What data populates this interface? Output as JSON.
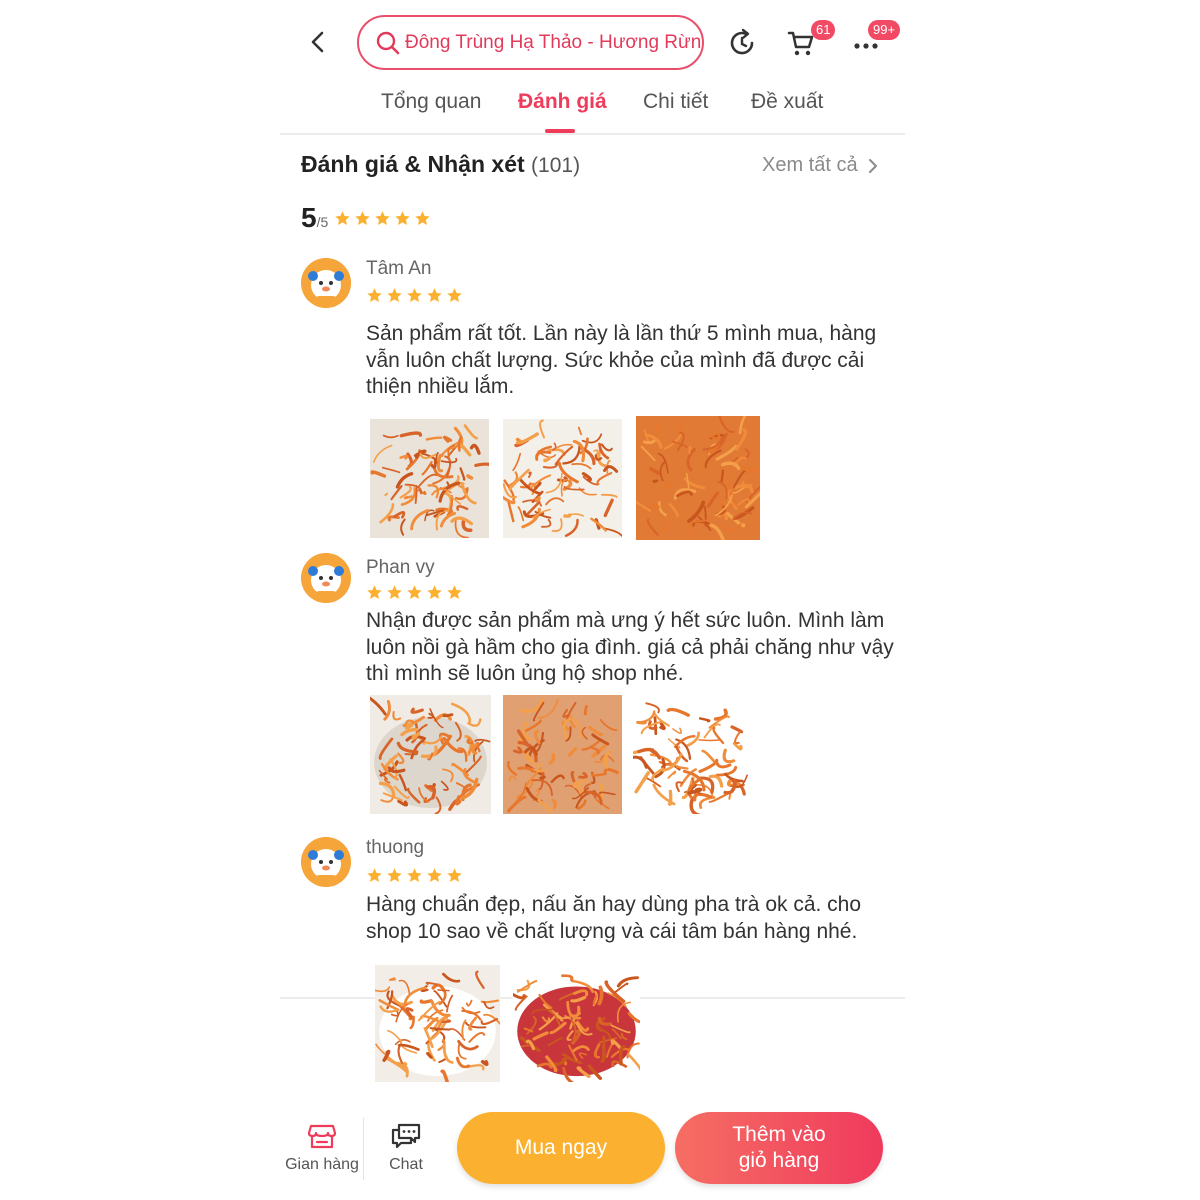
{
  "header": {
    "search_text": "Đông Trùng Hạ Thảo -  Hương Rừng",
    "cart_badge": "61",
    "more_badge": "99+"
  },
  "tabs": [
    {
      "label": "Tổng quan"
    },
    {
      "label": "Đánh giá"
    },
    {
      "label": "Chi tiết"
    },
    {
      "label": "Đề xuất"
    }
  ],
  "reviews_section": {
    "title": "Đánh giá & Nhận xét",
    "count": "(101)",
    "see_all": "Xem tất cả",
    "score": "5",
    "score_max": "/5",
    "rating_stars": 5
  },
  "reviews": [
    {
      "name": "Tâm An",
      "stars": 5,
      "lines": [
        "Sản phẩm rất tốt. Lần này là lần thứ 5 mình mua, hàng",
        "vẫn luôn chất lượng. Sức khỏe của mình đã được cải",
        "thiện nhiều lắm."
      ]
    },
    {
      "name": "Phan vy",
      "stars": 5,
      "lines": [
        "Nhận được sản phẩm mà ưng ý hết sức luôn. Mình làm",
        "luôn nồi gà hầm cho gia đình. giá cả phải chăng như vậy",
        "thì mình sẽ luôn ủng hộ shop nhé."
      ]
    },
    {
      "name": "thuong",
      "stars": 5,
      "lines": [
        "Hàng chuẩn đẹp, nấu ăn hay dùng pha trà ok cả. cho",
        "shop 10 sao về chất lượng và cái tâm bán hàng nhé."
      ]
    }
  ],
  "bottom_bar": {
    "shop_label": "Gian hàng",
    "chat_label": "Chat",
    "buy_now": "Mua ngay",
    "add_to_cart_line1": "Thêm vào",
    "add_to_cart_line2": "giỏ hàng"
  },
  "colors": {
    "accent": "#ef3c5a",
    "star": "#fbb12f",
    "buy": "#fbb12f"
  }
}
